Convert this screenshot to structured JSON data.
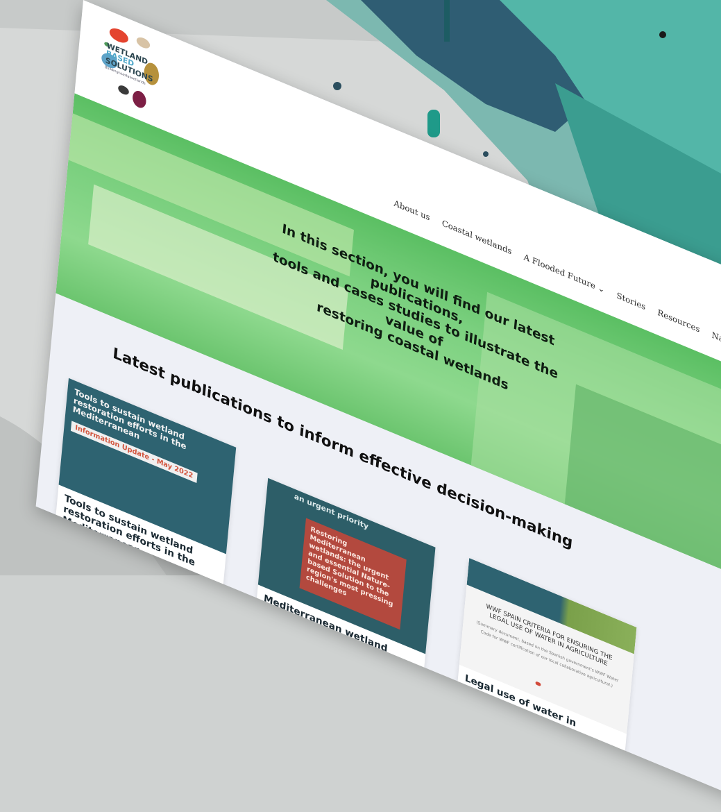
{
  "logo": {
    "line1": "WETLAND",
    "line2": "BASED",
    "line3": "SOLUTIONS",
    "tagline": "Buildingcoastalwetlands"
  },
  "nav": {
    "items": [
      {
        "label": "About us"
      },
      {
        "label": "Coastal wetlands"
      },
      {
        "label": "A Flooded Future ⌄"
      },
      {
        "label": "Stories"
      },
      {
        "label": "Resources"
      },
      {
        "label": "Nature-based solutions"
      }
    ]
  },
  "hero": {
    "line1": "In this section, you will find our latest publications,",
    "line2": "tools and cases studies to illustrate the value of",
    "line3": "restoring coastal wetlands"
  },
  "section": {
    "title": "Latest publications to inform effective decision-making"
  },
  "cards": [
    {
      "image_title": "Tools to sustain wetland restoration efforts in the Mediterranean",
      "image_badge": "Information Update - May 2022",
      "title": "Tools to sustain wetland restoration efforts in the Mediterranean"
    },
    {
      "image_top": "an urgent priority",
      "image_box": "Restoring Mediterranean wetlands: the urgent and essential Nature-based Solution to the region's most pressing challenges",
      "title": "Mediterranean wetland restoration: an urgent priority"
    },
    {
      "image_doc": "WWF SPAIN CRITERIA FOR ENSURING THE LEGAL USE OF WATER IN AGRICULTURE",
      "image_sub": "(Summary document, based on the Spanish government's WWF Water Code for WWF certification of our local collaborative agricultural.)",
      "title": "Legal use of water in agriculture"
    }
  ]
}
